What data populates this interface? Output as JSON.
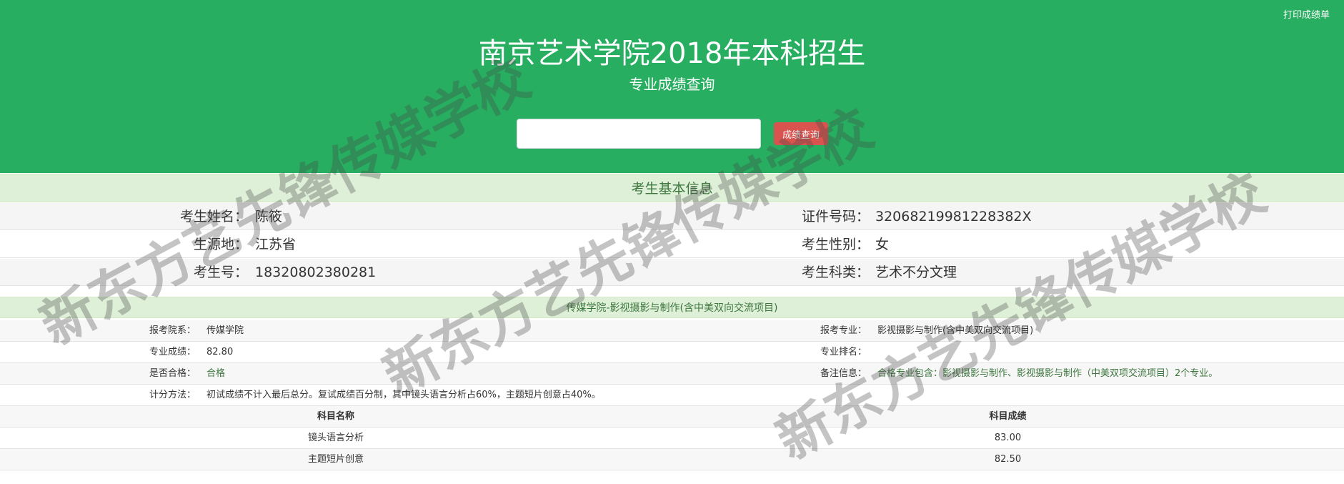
{
  "header": {
    "print_label": "打印成绩单",
    "title": "南京艺术学院2018年本科招生",
    "subtitle": "专业成绩查询",
    "search_value": "",
    "search_button_label": "成绩查询"
  },
  "basic_info": {
    "section_title": "考生基本信息",
    "rows": [
      {
        "left_label": "考生姓名：",
        "left_value": "陈筱",
        "right_label": "证件号码：",
        "right_value": "32068219981228382X"
      },
      {
        "left_label": "生源地：",
        "left_value": "江苏省",
        "right_label": "考生性别：",
        "right_value": "女"
      },
      {
        "left_label": "考生号：",
        "left_value": "18320802380281",
        "right_label": "考生科类：",
        "right_value": "艺术不分文理"
      }
    ]
  },
  "major": {
    "section_title": "传媒学院-影视摄影与制作(含中美双向交流项目)",
    "rows": [
      {
        "left_label": "报考院系：",
        "left_value": "传媒学院",
        "right_label": "报考专业：",
        "right_value": "影视摄影与制作(含中美双向交流项目)"
      },
      {
        "left_label": "专业成绩：",
        "left_value": "82.80",
        "right_label": "专业排名：",
        "right_value": ""
      },
      {
        "left_label": "是否合格：",
        "left_value": "合格",
        "right_label": "备注信息：",
        "right_value": "合格专业包含：影视摄影与制作、影视摄影与制作（中美双项交流项目）2个专业。"
      }
    ],
    "calc_label": "计分方法：",
    "calc_value": "初试成绩不计入最后总分。复试成绩百分制，其中镜头语言分析占60%，主题短片创意占40%。",
    "subjects_header": {
      "name": "科目名称",
      "score": "科目成绩"
    },
    "subjects": [
      {
        "name": "镜头语言分析",
        "score": "83.00"
      },
      {
        "name": "主题短片创意",
        "score": "82.50"
      }
    ]
  },
  "watermark": "新东方艺先锋传媒学校",
  "colors": {
    "header_green": "#27ae60",
    "section_green_bg": "#dff0d8",
    "section_green_text": "#3c763d",
    "button_red": "#d9534f"
  }
}
